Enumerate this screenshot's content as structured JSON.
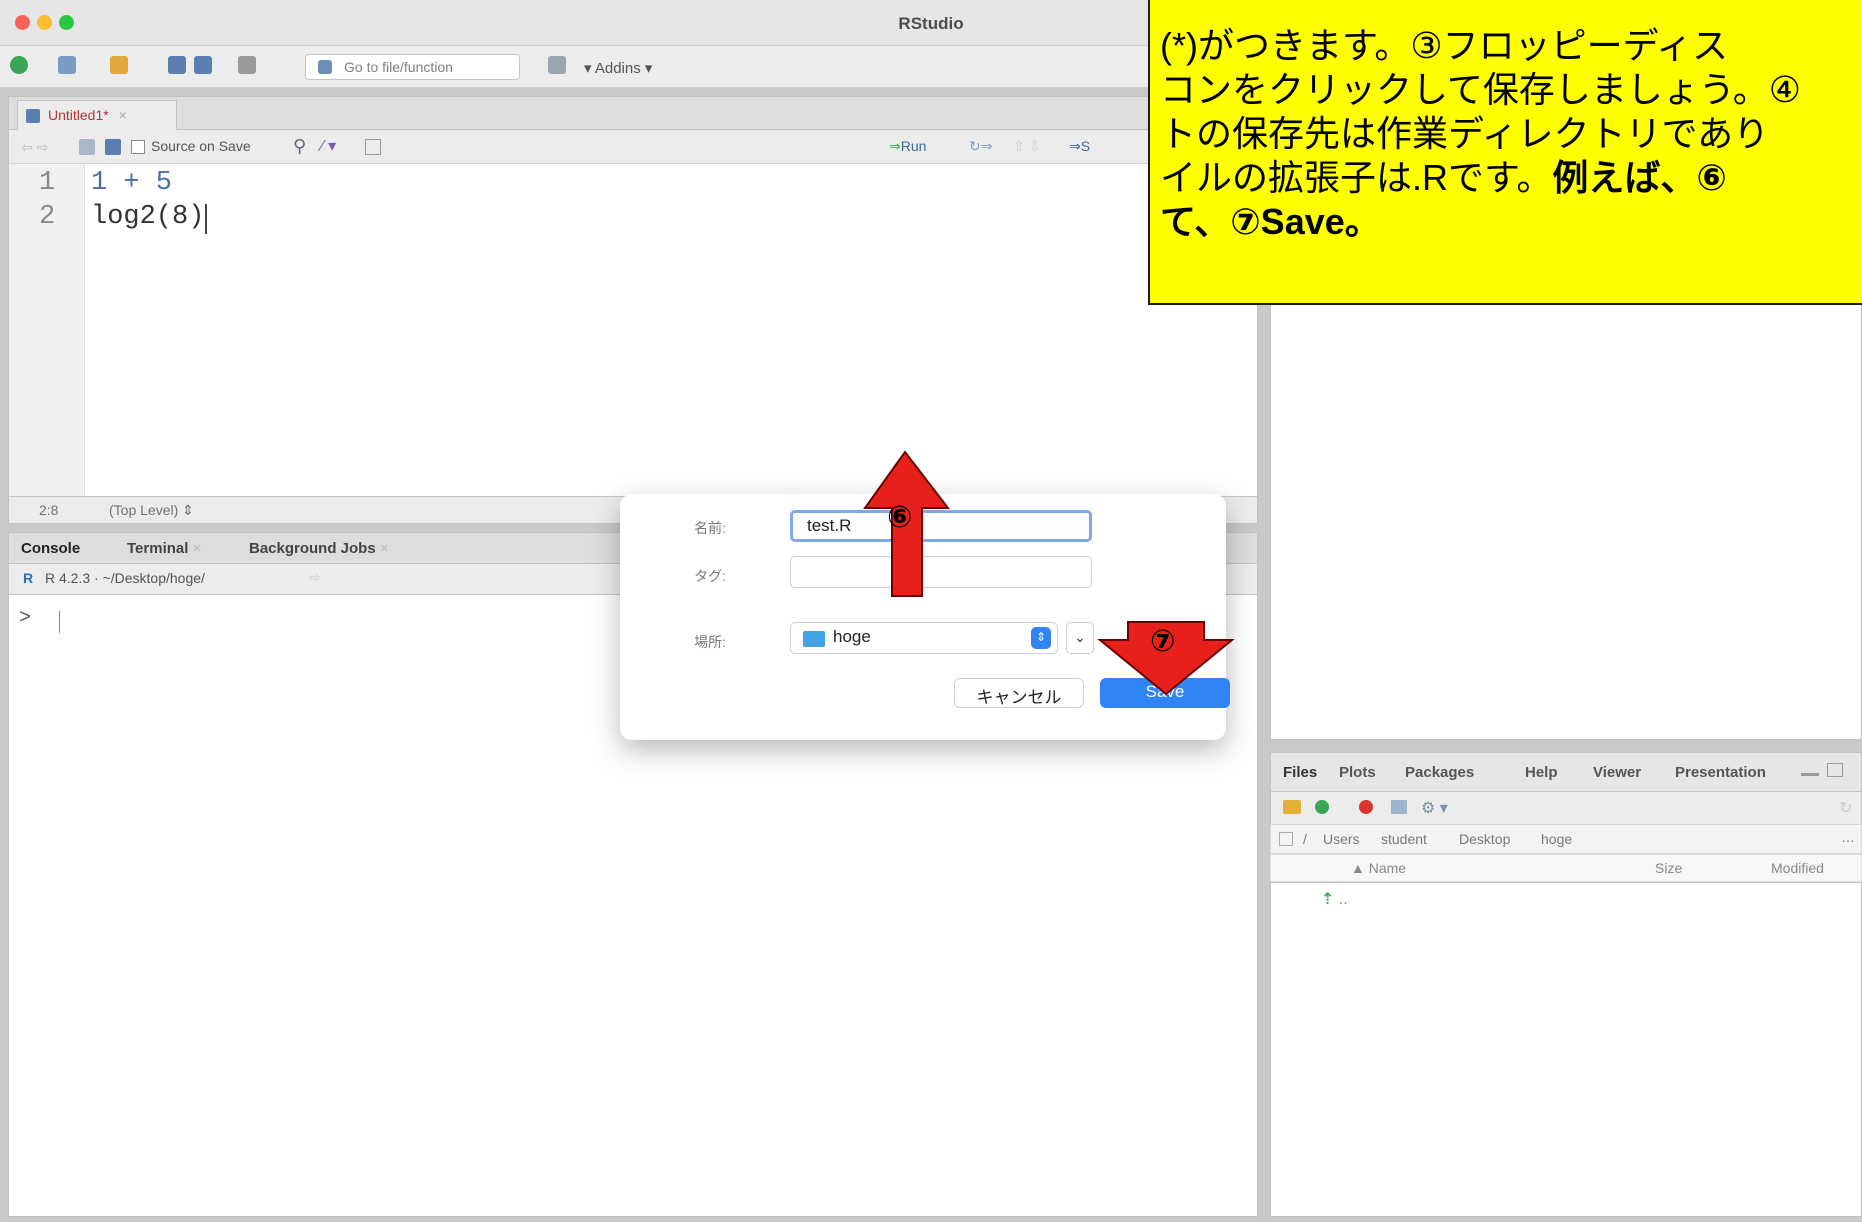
{
  "app": {
    "title": "RStudio"
  },
  "toolbar": {
    "goto_placeholder": "Go to file/function",
    "addins_label": "Addins"
  },
  "editor": {
    "tab_label": "Untitled1*",
    "source_on_save_label": "Source on Save",
    "run_label": "Run",
    "source_label_partial": "S",
    "lines": [
      {
        "num": "1",
        "code": "1 + 5"
      },
      {
        "num": "2",
        "code": "log2(8)"
      }
    ],
    "cursor_pos": "2:8",
    "scope": "(Top Level)"
  },
  "console": {
    "tabs": [
      "Console",
      "Terminal",
      "Background Jobs"
    ],
    "version_path": "R 4.2.3 · ~/Desktop/hoge/",
    "prompt": ">"
  },
  "files_pane": {
    "tabs": [
      "Files",
      "Plots",
      "Packages",
      "Help",
      "Viewer",
      "Presentation"
    ],
    "breadcrumb": [
      "/",
      "Users",
      "student",
      "Desktop",
      "hoge"
    ],
    "columns": [
      "Name",
      "Size",
      "Modified"
    ],
    "rows": [
      ".."
    ]
  },
  "dialog": {
    "name_label": "名前:",
    "name_value": "test.R",
    "tags_label": "タグ:",
    "location_label": "場所:",
    "location_value": "hoge",
    "cancel_label": "キャンセル",
    "save_label": "Save"
  },
  "annotation": {
    "line1": "(*)がつきます。③フロッピーディス",
    "line2": "コンをクリックして保存しましょう。④",
    "line3": "トの保存先は作業ディレクトリであり",
    "line4_plain": "イルの拡張子は.Rです。",
    "line4_bold": "例えば、⑥",
    "line5": "て、⑦Save。",
    "marker6": "⑥",
    "marker7": "⑦",
    "color": "#ffff00"
  },
  "colors": {
    "arrow_red": "#e8201c",
    "save_blue": "#2f84f6",
    "close_red": "#fe5f57",
    "minimize_yellow": "#febb2e",
    "zoom_green": "#28c840"
  }
}
